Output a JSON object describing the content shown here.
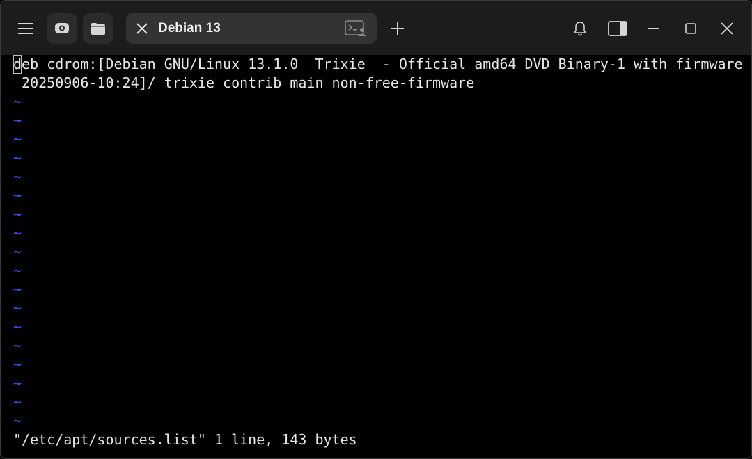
{
  "titlebar": {
    "tab_title": "Debian 13",
    "icons": {
      "menu": "hamburger-menu-icon",
      "profile": "profile-icon",
      "folder": "folder-icon",
      "tab_close": "close-icon",
      "tab_terminal": "terminal-profile-icon",
      "add_tab": "plus-icon",
      "notifications": "bell-icon",
      "panel": "side-panel-icon",
      "minimize": "minimize-icon",
      "maximize": "maximize-icon",
      "close": "close-icon"
    }
  },
  "editor": {
    "cursor_char": "d",
    "line1_rest": "eb cdrom:[Debian GNU/Linux 13.1.0 _Trixie_ - Official amd64 DVD Binary-1 with firmware",
    "line2": " 20250906-10:24]/ trixie contrib main non-free-firmware",
    "tilde_char": "~",
    "tilde_count": 18,
    "status": "\"/etc/apt/sources.list\" 1 line, 143 bytes"
  },
  "colors": {
    "background": "#000000",
    "titlebar": "#1c1c1c",
    "tab": "#333333",
    "text": "#e6e6e6",
    "tilde": "#3b5bff"
  }
}
